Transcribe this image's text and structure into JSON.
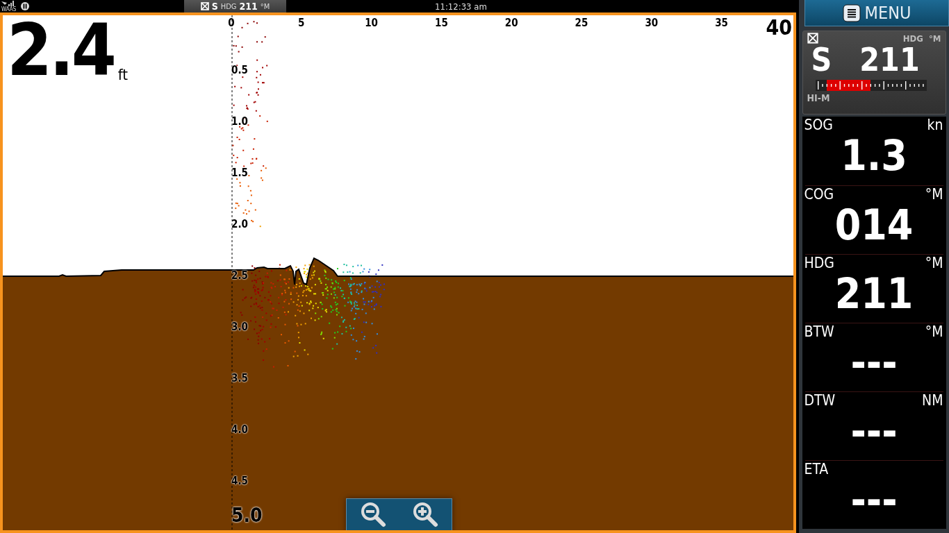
{
  "status_bar": {
    "gps_label": "WAAS",
    "heading_widget": {
      "direction": "S",
      "label": "HDG",
      "value": "211",
      "unit": "°M"
    },
    "time": "11:12:33 am"
  },
  "sonar": {
    "depth": "2.4",
    "depth_unit": "ft",
    "range_label": "40",
    "x_labels": [
      "0",
      "5",
      "10",
      "15",
      "20",
      "25",
      "30",
      "35"
    ],
    "y_labels": [
      "0.5",
      "1.0",
      "1.5",
      "2.0",
      "2.5",
      "3.0",
      "3.5",
      "4.0",
      "4.5"
    ],
    "bottom_label": "5.0"
  },
  "menu_button": {
    "label": "MENU"
  },
  "heading_card": {
    "label": "HDG",
    "unit": "°M",
    "direction": "S",
    "value": "211",
    "mode": "HI-M"
  },
  "data_panels": [
    {
      "label": "SOG",
      "unit": "kn",
      "value": "1.3"
    },
    {
      "label": "COG",
      "unit": "°M",
      "value": "014"
    },
    {
      "label": "HDG",
      "unit": "°M",
      "value": "211"
    },
    {
      "label": "BTW",
      "unit": "°M",
      "value": "---"
    },
    {
      "label": "DTW",
      "unit": "NM",
      "value": "---"
    },
    {
      "label": "ETA",
      "value": "---"
    }
  ]
}
